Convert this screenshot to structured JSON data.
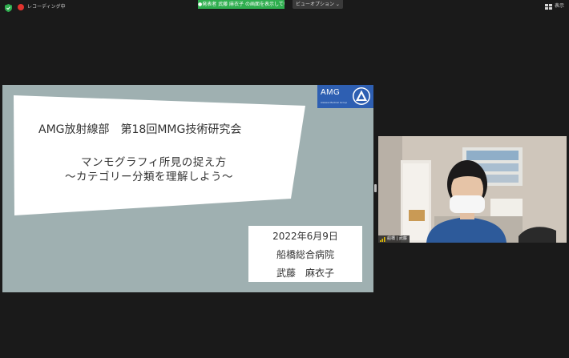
{
  "topbar": {
    "recording_label": "レコーディング中",
    "banner_text": "●発表者 武藤 麻衣子 の画面を表示しています",
    "view_options": "ビューオプション ⌄",
    "view_button": "表示"
  },
  "slide": {
    "title": "AMG放射線部　第18回MMG技術研究会",
    "subtitle_line1": "マンモグラフィ所見の捉え方",
    "subtitle_line2": "〜カテゴリー分類を理解しよう〜",
    "logo_text": "AMG",
    "logo_subtext": "Aizawa Medical Group",
    "date": "2022年6月9日",
    "hospital": "船橋総合病院",
    "presenter": "武藤　麻衣子"
  },
  "camera": {
    "participant_name": "船橋 | 武藤"
  },
  "colors": {
    "background": "#1a1a1a",
    "slide_bg": "#9fb0b1",
    "share_banner": "#2fae4f",
    "logo_blue": "#2e5fb2",
    "record_red": "#e0332e"
  }
}
